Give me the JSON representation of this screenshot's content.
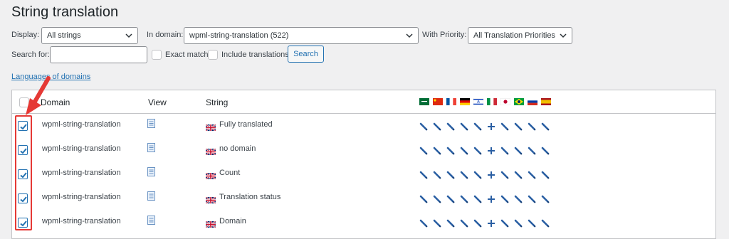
{
  "page": {
    "title": "String translation"
  },
  "filters": {
    "display_label": "Display:",
    "display_value": "All strings",
    "domain_label": "In domain:",
    "domain_value": "wpml-string-translation (522)",
    "priority_label": "With Priority:",
    "priority_value": "All Translation Priorities",
    "search_label": "Search for:",
    "search_value": "",
    "exact_match_label": "Exact match",
    "include_translations_label": "Include translations",
    "search_button": "Search"
  },
  "languages_link": "Languages of domains",
  "table": {
    "headers": {
      "domain": "Domain",
      "view": "View",
      "string": "String"
    },
    "flags": [
      "ar",
      "zh",
      "fr",
      "de",
      "he",
      "it",
      "ja",
      "pt-br",
      "ru",
      "es"
    ],
    "rows": [
      {
        "domain": "wpml-string-translation",
        "string": "Fully translated",
        "checked": true
      },
      {
        "domain": "wpml-string-translation",
        "string": "no domain",
        "checked": true
      },
      {
        "domain": "wpml-string-translation",
        "string": "Count",
        "checked": true
      },
      {
        "domain": "wpml-string-translation",
        "string": "Translation status",
        "checked": true
      },
      {
        "domain": "wpml-string-translation",
        "string": "Domain",
        "checked": true
      }
    ],
    "status_icons": [
      "pencil",
      "pencil",
      "pencil",
      "pencil",
      "pencil",
      "plus",
      "pencil",
      "pencil",
      "pencil",
      "pencil"
    ]
  },
  "colors": {
    "accent": "#2271b1",
    "callout": "#e53935",
    "icon": "#2a5fa3"
  }
}
